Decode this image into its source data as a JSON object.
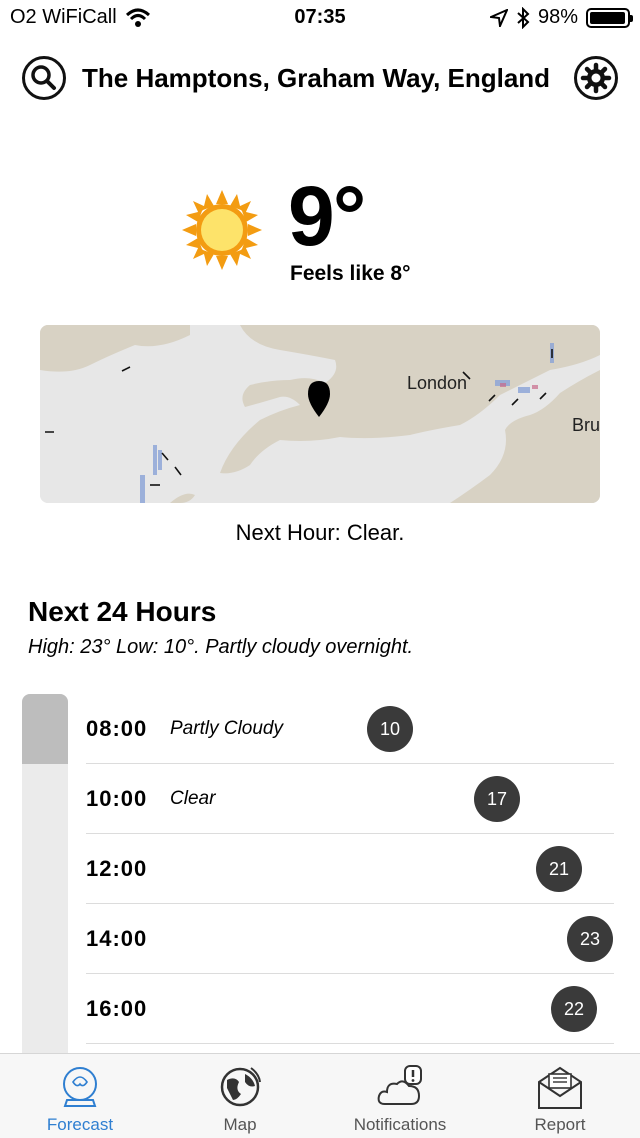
{
  "status_bar": {
    "carrier": "O2 WiFiCall",
    "time": "07:35",
    "battery": "98%",
    "battery_level": 0.98
  },
  "header": {
    "location": "The Hamptons, Graham Way, England",
    "search_icon": "search-icon",
    "settings_icon": "gear-icon"
  },
  "current": {
    "temperature": "9°",
    "feels_like": "Feels like 8°",
    "condition_icon": "sun-icon"
  },
  "map": {
    "labels": [
      "London",
      "Bru"
    ]
  },
  "next_hour": "Next Hour: Clear.",
  "next24": {
    "title": "Next 24 Hours",
    "summary": "High: 23° Low: 10°. Partly cloudy overnight.",
    "rows": [
      {
        "time": "08:00",
        "condition": "Partly Cloudy",
        "temp": "10"
      },
      {
        "time": "10:00",
        "condition": "Clear",
        "temp": "17"
      },
      {
        "time": "12:00",
        "condition": "",
        "temp": "21"
      },
      {
        "time": "14:00",
        "condition": "",
        "temp": "23"
      },
      {
        "time": "16:00",
        "condition": "",
        "temp": "22"
      }
    ]
  },
  "tabs": [
    {
      "label": "Forecast",
      "icon": "crystal-ball-icon",
      "active": true
    },
    {
      "label": "Map",
      "icon": "globe-icon",
      "active": false
    },
    {
      "label": "Notifications",
      "icon": "cloud-alert-icon",
      "active": false
    },
    {
      "label": "Report",
      "icon": "mail-icon",
      "active": false
    }
  ],
  "colors": {
    "accent": "#2f7fd1",
    "sun": "#f39c12",
    "sun_core": "#fde36a",
    "bubble": "#3a3a3a"
  }
}
